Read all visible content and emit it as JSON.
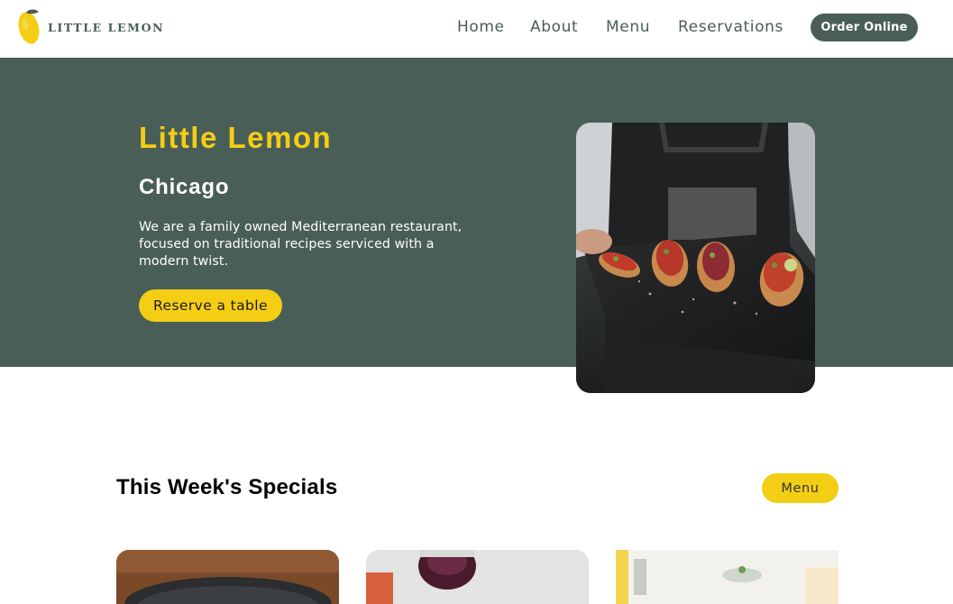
{
  "brand": {
    "logo_text": "LITTLE LEMON",
    "logo_icon": "lemon-icon"
  },
  "nav": {
    "items": [
      {
        "label": "Home"
      },
      {
        "label": "About"
      },
      {
        "label": "Menu"
      },
      {
        "label": "Reservations"
      }
    ],
    "order_label": "Order Online"
  },
  "hero": {
    "title": "Little Lemon",
    "subtitle": "Chicago",
    "description": "We are a family owned Mediterranean restaurant, focused on traditional recipes serviced with a modern twist.",
    "cta_label": "Reserve a table",
    "image": "bruschetta-platter-photo"
  },
  "specials": {
    "title": "This Week's Specials",
    "menu_label": "Menu",
    "cards": [
      {
        "image": "greek-salad-photo"
      },
      {
        "image": "bruschetta-photo"
      },
      {
        "image": "lemon-dessert-photo"
      }
    ]
  },
  "colors": {
    "primary_green": "#495e57",
    "primary_yellow": "#f4ce14",
    "white": "#ffffff"
  }
}
